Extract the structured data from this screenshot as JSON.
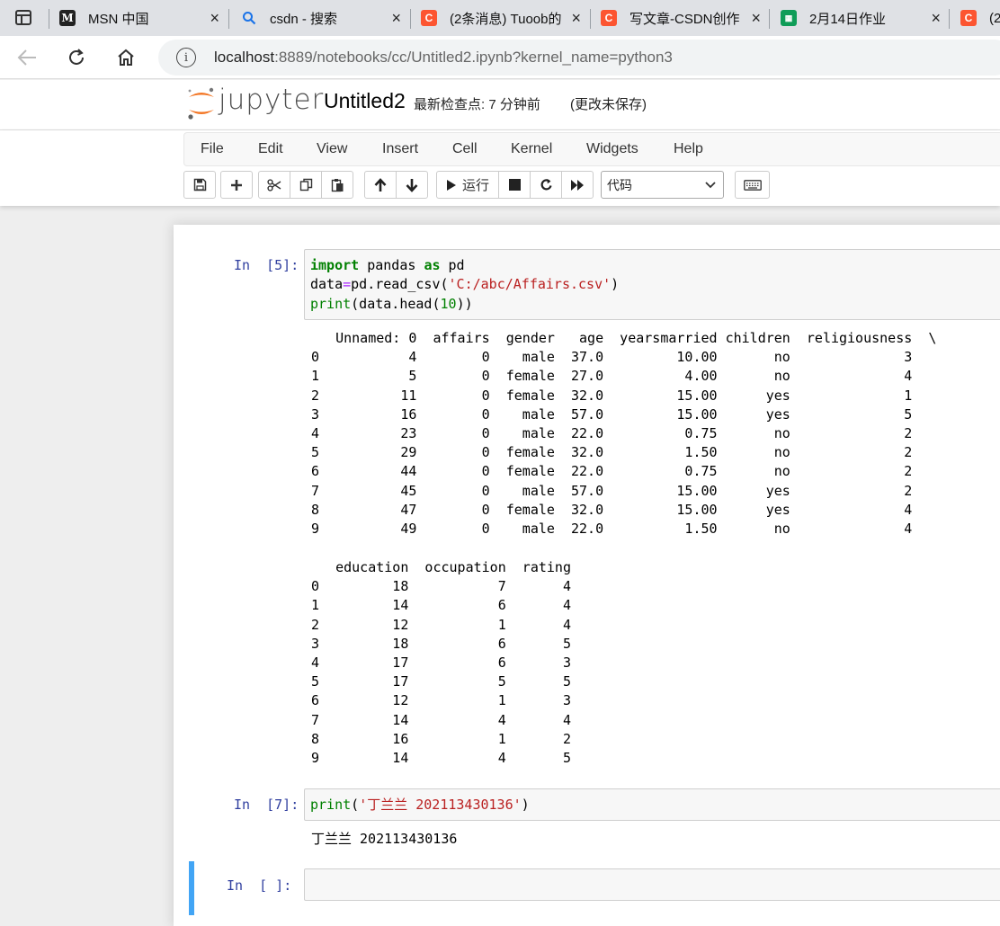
{
  "browser": {
    "tabs": [
      {
        "title": "MSN 中国",
        "icon": "msn-icon"
      },
      {
        "title": "csdn - 搜索",
        "icon": "search-icon"
      },
      {
        "title": "(2条消息) Tuoob的",
        "icon": "csdn-icon"
      },
      {
        "title": "写文章-CSDN创作",
        "icon": "csdn-icon"
      },
      {
        "title": "2月14日作业",
        "icon": "sheets-icon"
      },
      {
        "title": "(2",
        "icon": "csdn-icon"
      }
    ],
    "close_glyph": "×",
    "address": {
      "host": "localhost",
      "rest": ":8889/notebooks/cc/Untitled2.ipynb?kernel_name=python3"
    }
  },
  "jupyter": {
    "logo_text": "jupyter",
    "notebook_name": "Untitled2",
    "checkpoint": "最新检查点: 7 分钟前",
    "save_status": "(更改未保存)",
    "menu": [
      "File",
      "Edit",
      "View",
      "Insert",
      "Cell",
      "Kernel",
      "Widgets",
      "Help"
    ],
    "toolbar": {
      "run_label": "运行",
      "cell_type": "代码"
    }
  },
  "cells": {
    "cell1": {
      "prompt": "In  [5]:",
      "code_line1": {
        "kw1": "import",
        "mid": " pandas ",
        "kw2": "as",
        "end": " pd"
      },
      "code_line2": {
        "pre": "data",
        "op": "=",
        "call": "pd.read_csv(",
        "str": "'C:/abc/Affairs.csv'",
        "close": ")"
      },
      "code_line3": {
        "fn": "print",
        "a": "(data.head(",
        "num": "10",
        "b": "))"
      },
      "output_part1": "   Unnamed: 0  affairs  gender   age  yearsmarried children  religiousness  \\\n0           4        0    male  37.0         10.00       no              3   \n1           5        0  female  27.0          4.00       no              4   \n2          11        0  female  32.0         15.00      yes              1   \n3          16        0    male  57.0         15.00      yes              5   \n4          23        0    male  22.0          0.75       no              2   \n5          29        0  female  32.0          1.50       no              2   \n6          44        0  female  22.0          0.75       no              2   \n7          45        0    male  57.0         15.00      yes              2   \n8          47        0  female  32.0         15.00      yes              4   \n9          49        0    male  22.0          1.50       no              4   ",
      "output_part2": "   education  occupation  rating\n0         18           7       4\n1         14           6       4\n2         12           1       4\n3         18           6       5\n4         17           6       3\n5         17           5       5\n6         12           1       3\n7         14           4       4\n8         16           1       2\n9         14           4       5"
    },
    "cell2": {
      "prompt": "In  [7]:",
      "code": {
        "fn": "print",
        "open": "(",
        "str": "'丁兰兰 202113430136'",
        "close": ")"
      },
      "output": "丁兰兰 202113430136"
    },
    "cell3": {
      "prompt": "In  [ ]:"
    }
  }
}
